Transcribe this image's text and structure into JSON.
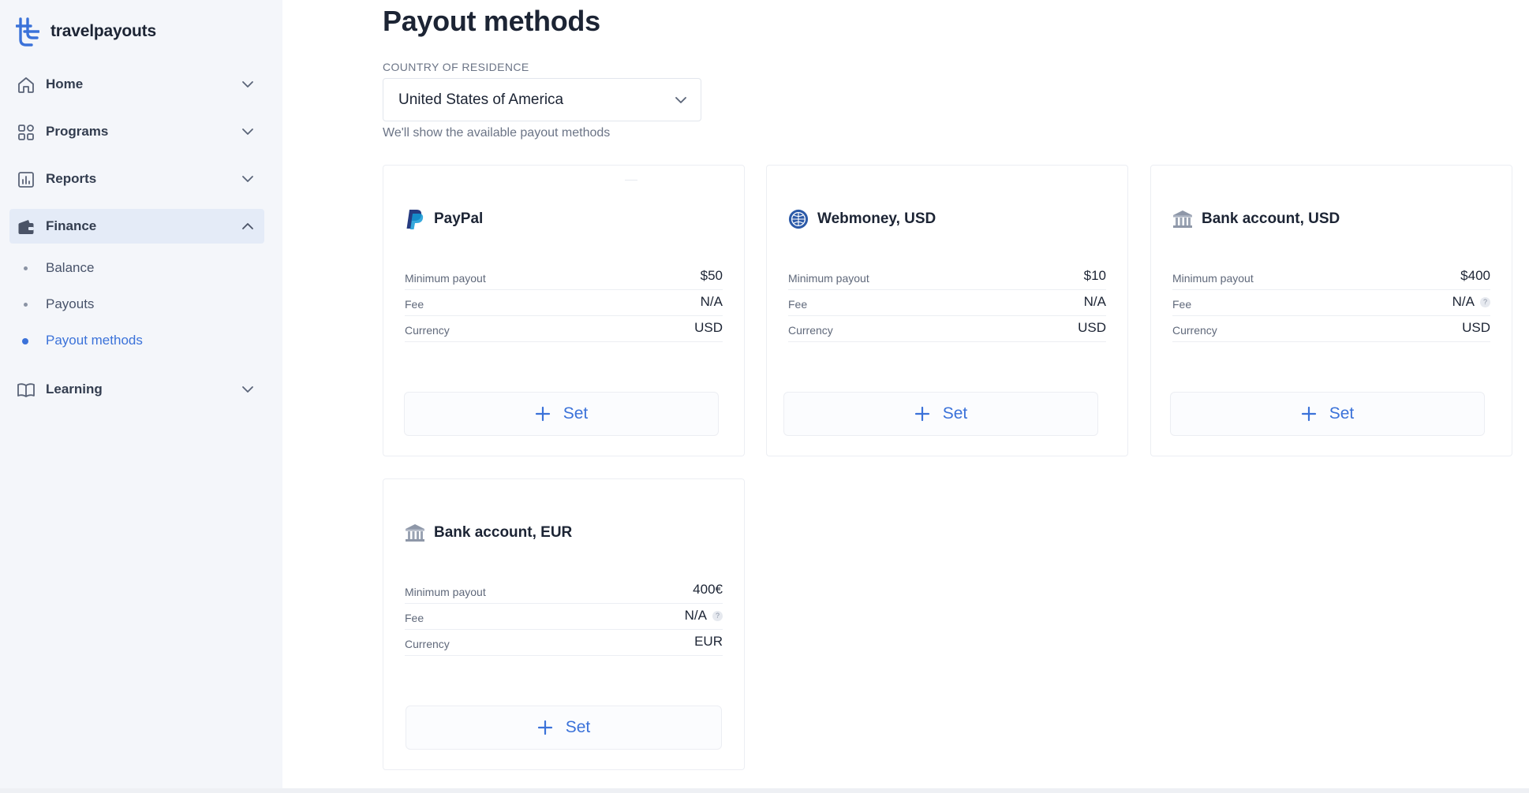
{
  "brand": {
    "name": "travelpayouts"
  },
  "colors": {
    "accent": "#3b72d9",
    "sidebar_bg": "#f4f6fa",
    "active_bg": "#e4ebf7",
    "text": "#1c2434"
  },
  "nav": {
    "items": [
      {
        "label": "Home",
        "icon": "home-icon",
        "chevron": "chevron-down-icon"
      },
      {
        "label": "Programs",
        "icon": "grid-icon",
        "chevron": "chevron-down-icon"
      },
      {
        "label": "Reports",
        "icon": "bar-chart-icon",
        "chevron": "chevron-down-icon"
      },
      {
        "label": "Finance",
        "icon": "wallet-icon",
        "chevron": "chevron-up-icon",
        "active": true
      },
      {
        "label": "Learning",
        "icon": "book-icon",
        "chevron": "chevron-down-icon"
      }
    ],
    "finance_sub": [
      {
        "label": "Balance"
      },
      {
        "label": "Payouts"
      },
      {
        "label": "Payout methods",
        "active": true
      }
    ]
  },
  "page": {
    "title": "Payout methods",
    "country_label": "COUNTRY OF RESIDENCE",
    "country_value": "United States of America",
    "country_hint": "We'll show the available payout methods"
  },
  "methods": [
    {
      "title": "PayPal",
      "icon": "paypal-icon",
      "min_label": "Minimum payout",
      "min": "$50",
      "fee_label": "Fee",
      "fee": "N/A",
      "cur_label": "Currency",
      "cur": "USD",
      "button": "Set"
    },
    {
      "title": "Webmoney, USD",
      "icon": "webmoney-icon",
      "min_label": "Minimum payout",
      "min": "$10",
      "fee_label": "Fee",
      "fee": "N/A",
      "cur_label": "Currency",
      "cur": "USD",
      "button": "Set"
    },
    {
      "title": "Bank account, USD",
      "icon": "bank-icon",
      "min_label": "Minimum payout",
      "min": "$400",
      "fee_label": "Fee",
      "fee": "N/A",
      "fee_help": "?",
      "cur_label": "Currency",
      "cur": "USD",
      "button": "Set"
    },
    {
      "title": "Bank account, EUR",
      "icon": "bank-icon",
      "min_label": "Minimum payout",
      "min": "400€",
      "fee_label": "Fee",
      "fee": "N/A",
      "fee_help": "?",
      "cur_label": "Currency",
      "cur": "EUR",
      "button": "Set"
    }
  ]
}
